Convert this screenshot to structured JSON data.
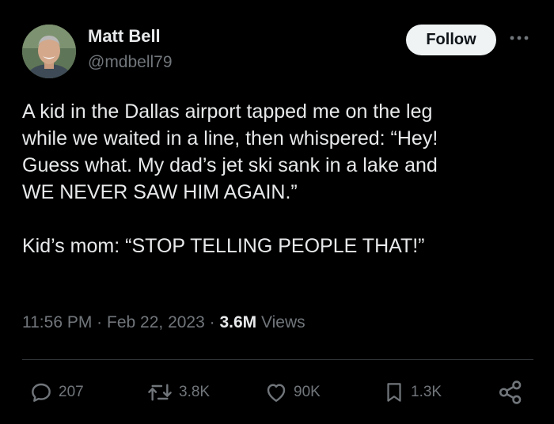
{
  "author": {
    "display_name": "Matt Bell",
    "handle": "@mdbell79",
    "avatar_icon": "profile-photo"
  },
  "header": {
    "follow_label": "Follow",
    "more_icon": "more-dots-icon"
  },
  "tweet": {
    "lines": [
      "A kid in the Dallas airport tapped me on the leg",
      "while we waited in a line, then whispered: “Hey!",
      "Guess what. My dad’s jet ski sank in a lake and",
      "WE NEVER SAW HIM AGAIN.”"
    ],
    "second_paragraph": "Kid’s mom: “STOP TELLING PEOPLE THAT!”"
  },
  "meta": {
    "time": "11:56 PM",
    "separator": "·",
    "date": "Feb 22, 2023",
    "views_count": "3.6M",
    "views_label": "Views"
  },
  "actions": {
    "replies": "207",
    "reposts": "3.8K",
    "likes": "90K",
    "bookmarks": "1.3K"
  },
  "colors": {
    "background": "#000000",
    "primary_text": "#e7e9ea",
    "secondary_text": "#71767b",
    "divider": "#2f3336",
    "follow_bg": "#eff3f4"
  }
}
